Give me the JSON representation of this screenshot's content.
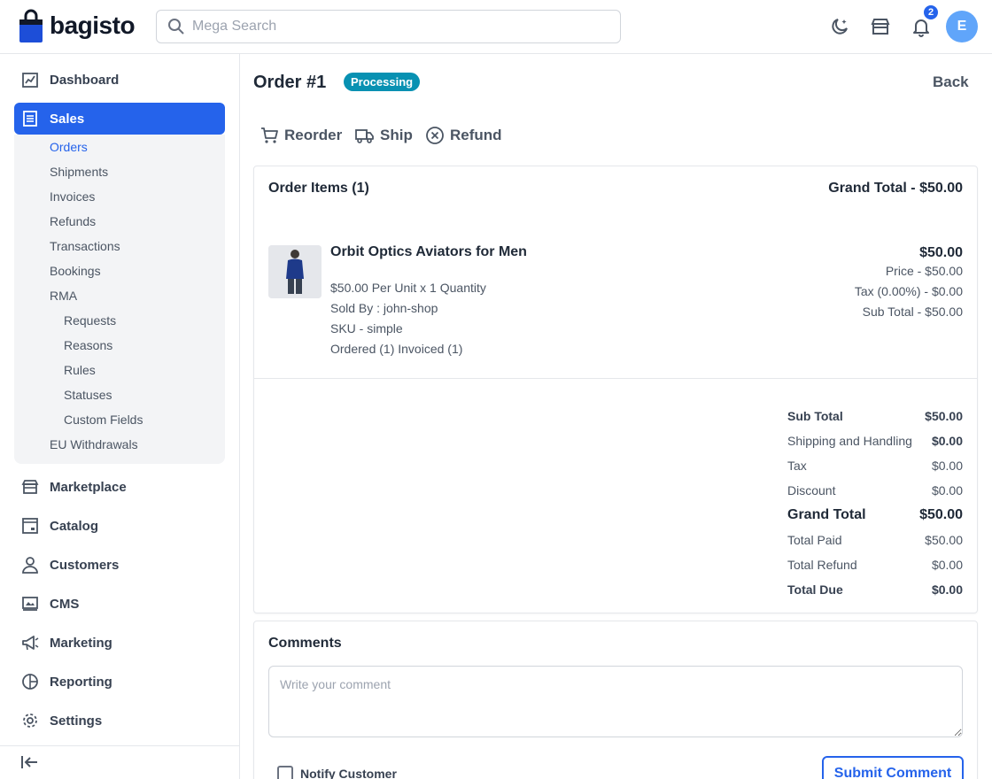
{
  "header": {
    "logo_text": "bagisto",
    "search_placeholder": "Mega Search",
    "notification_count": "2",
    "avatar_initial": "E"
  },
  "sidebar": {
    "items": [
      {
        "label": "Dashboard",
        "icon": "dashboard-icon"
      },
      {
        "label": "Sales",
        "icon": "sales-icon",
        "active": true
      },
      {
        "label": "Marketplace",
        "icon": "store-icon"
      },
      {
        "label": "Catalog",
        "icon": "catalog-icon"
      },
      {
        "label": "Customers",
        "icon": "user-icon"
      },
      {
        "label": "CMS",
        "icon": "cms-icon"
      },
      {
        "label": "Marketing",
        "icon": "megaphone-icon"
      },
      {
        "label": "Reporting",
        "icon": "pie-chart-icon"
      },
      {
        "label": "Settings",
        "icon": "gear-icon"
      }
    ],
    "sales_sub": [
      "Orders",
      "Shipments",
      "Invoices",
      "Refunds",
      "Transactions",
      "Bookings",
      "RMA"
    ],
    "rma_sub": [
      "Requests",
      "Reasons",
      "Rules",
      "Statuses",
      "Custom Fields"
    ],
    "eu_withdrawals": "EU Withdrawals"
  },
  "page": {
    "title": "Order #1",
    "status": "Processing",
    "back": "Back",
    "actions": [
      "Reorder",
      "Ship",
      "Refund"
    ]
  },
  "order_items": {
    "title": "Order Items (1)",
    "grand_total": "Grand Total - $50.00",
    "product": {
      "name": "Orbit Optics Aviators for Men",
      "unit_qty": "$50.00 Per Unit x 1 Quantity",
      "sold_by": "Sold By : john-shop",
      "sku": "SKU - simple",
      "status": "Ordered (1) Invoiced (1)",
      "total": "$50.00",
      "price": "Price - $50.00",
      "tax": "Tax (0.00%) - $0.00",
      "sub_total": "Sub Total - $50.00"
    }
  },
  "summary": [
    {
      "label": "Sub Total",
      "value": "$50.00",
      "style": "b"
    },
    {
      "label": "Shipping and Handling",
      "value": "$0.00",
      "style": "vb"
    },
    {
      "label": "Tax",
      "value": "$0.00",
      "style": ""
    },
    {
      "label": "Discount",
      "value": "$0.00",
      "style": ""
    },
    {
      "label": "Grand Total",
      "value": "$50.00",
      "style": "big"
    },
    {
      "label": "Total Paid",
      "value": "$50.00",
      "style": ""
    },
    {
      "label": "Total Refund",
      "value": "$0.00",
      "style": ""
    },
    {
      "label": "Total Due",
      "value": "$0.00",
      "style": "b"
    }
  ],
  "comments": {
    "title": "Comments",
    "placeholder": "Write your comment",
    "notify_label": "Notify Customer",
    "submit": "Submit Comment"
  },
  "colors": {
    "accent": "#2563eb",
    "status": "#0891b2"
  }
}
